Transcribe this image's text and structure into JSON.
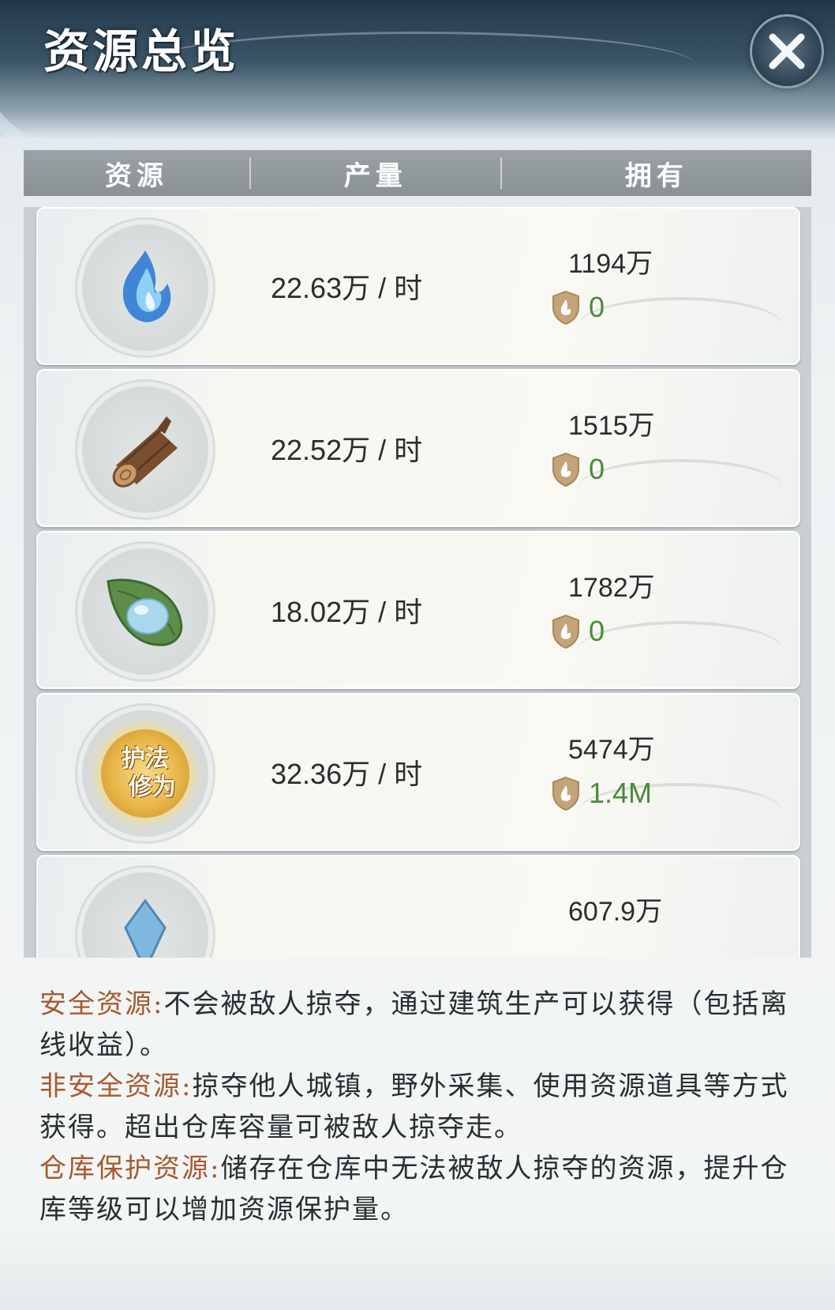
{
  "title": "资源总览",
  "columns": [
    "资源",
    "产量",
    "拥有"
  ],
  "rows": [
    {
      "icon": "blue-flame-icon",
      "production": "22.63万 / 时",
      "owned": "1194万",
      "protected": "0"
    },
    {
      "icon": "wood-log-icon",
      "production": "22.52万 / 时",
      "owned": "1515万",
      "protected": "0"
    },
    {
      "icon": "water-drop-leaf-icon",
      "production": "18.02万 / 时",
      "owned": "1782万",
      "protected": "0"
    },
    {
      "icon": "guardian-cultivation-icon",
      "icon_text": [
        "护法",
        "修为"
      ],
      "production": "32.36万 / 时",
      "owned": "5474万",
      "protected": "1.4M"
    },
    {
      "icon": "crystal-icon",
      "production": "",
      "owned": "607.9万",
      "protected": ""
    }
  ],
  "notes": [
    {
      "label": "安全资源:",
      "text": "不会被敌人掠夺，通过建筑生产可以获得（包括离线收益）。"
    },
    {
      "label": "非安全资源:",
      "text": "掠夺他人城镇，野外采集、使用资源道具等方式获得。超出仓库容量可被敌人掠夺走。"
    },
    {
      "label": "仓库保护资源:",
      "text": "储存在仓库中无法被敌人掠夺的资源，提升仓库等级可以增加资源保护量。"
    }
  ],
  "colors": {
    "label": "#a85a2e",
    "protected_value": "#4a8a3a",
    "shield": "#c4a37a"
  }
}
